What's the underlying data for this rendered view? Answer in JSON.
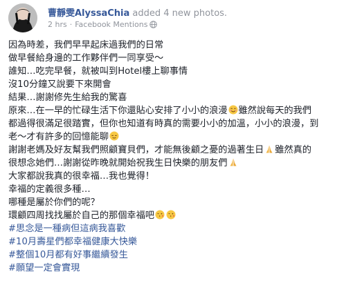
{
  "post": {
    "author": "曹靜雯AlyssaChia",
    "action": "added 4 new photos.",
    "time": "2 hrs",
    "separator": "·",
    "source": "Facebook Mentions",
    "visibility_icon": "globe-icon",
    "lines": [
      "因為時差，我們早早起床過我們的日常",
      "做早餐給身邊的工作夥伴們一同享受～",
      "誰知…吃完早餐，就被叫到Hotel樓上聊事情",
      "沒10分鐘又說要下來開會",
      "結果…謝謝修先生給我的驚喜",
      "原來…在一早的忙碌生活下你還貼心安排了小小的浪漫",
      "雖然說每天的我們",
      "都過得很滿足很踏實，但你也知道有時真的需要小小的加溫，小小的浪漫，到",
      "老～才有許多的回憶能聊",
      "謝謝老媽及好友幫我們照顧寶貝們，才能無後顧之憂的過著生日",
      "雖然真的",
      "很想念她們…謝謝從昨晚就開始祝我生日快樂的朋友們",
      "大家都說我真的很幸福…我也覺得！",
      "幸福的定義很多種…",
      "哪種是屬於你們的呢？",
      "環顧四周找找屬於自己的那個幸福吧"
    ],
    "hashtags": [
      "#思念是一種病但這病我喜歡",
      "#10月壽星們都幸福健康大快樂",
      "#整個10月都有好事繼續發生",
      "#願望一定會實現"
    ],
    "emojis": {
      "smile": "smiling-face-emoji",
      "pray": "folded-hands-emoji",
      "relieved": "relieved-face-emoji",
      "kiss": "face-blowing-kiss-emoji"
    },
    "colors": {
      "link": "#365899",
      "meta": "#90949c",
      "text": "#1d2129"
    }
  }
}
